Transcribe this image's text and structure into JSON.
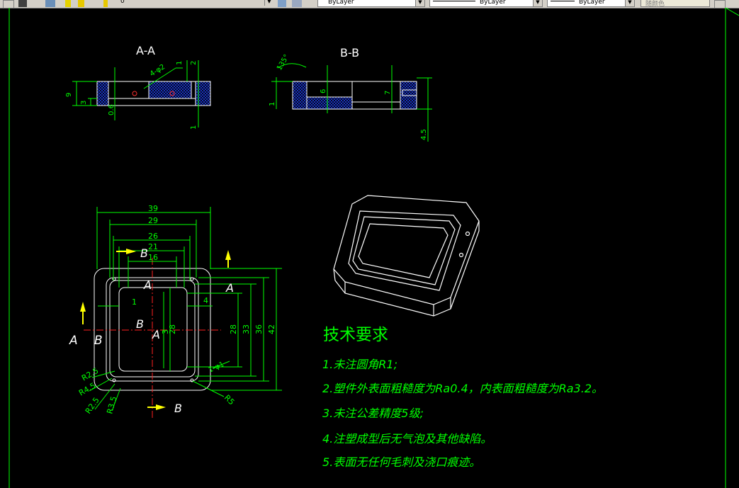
{
  "toolbar": {
    "layer_value": "0",
    "color_value": "ByLayer",
    "linetype_value": "ByLayer",
    "lineweight_value": "ByLayer",
    "plotstyle_value": "随颜色"
  },
  "colors": {
    "background": "#000000",
    "geometry": "#ffffff",
    "dimension": "#00ff00",
    "annotation": "#ffff00",
    "centerline": "#ff0000",
    "hatch": "#0000ff",
    "axis": "#00ff00"
  },
  "views": {
    "aa_title": "A-A",
    "bb_title": "B-B",
    "aa_dims": [
      "9",
      "3",
      "0.6",
      "1",
      "2",
      "1",
      "4-φ2"
    ],
    "bb_dims": [
      "135°",
      "1",
      "6",
      "7",
      "4.5"
    ]
  },
  "plan": {
    "dims_horizontal": [
      "39",
      "29",
      "26",
      "21",
      "16"
    ],
    "dims_vertical": [
      "28",
      "33",
      "36",
      "42"
    ],
    "dims_inner": [
      "1",
      "4",
      "3",
      "28"
    ],
    "radii": [
      "R2.5",
      "R4.5",
      "R2.5",
      "R3.5",
      "R5",
      "1-φ1"
    ],
    "section_labels": [
      "A",
      "B",
      "A",
      "B",
      "A",
      "A",
      "B",
      "B"
    ]
  },
  "notes": {
    "heading": "技术要求",
    "items": [
      "1.未注圆角R1;",
      "2.塑件外表面粗糙度为Ra0.4，内表面粗糙度为Ra3.2。",
      "3.未注公差精度5级;",
      "4.注塑成型后无气泡及其他缺陷。",
      "5.表面无任何毛刺及浇口痕迹。"
    ]
  }
}
